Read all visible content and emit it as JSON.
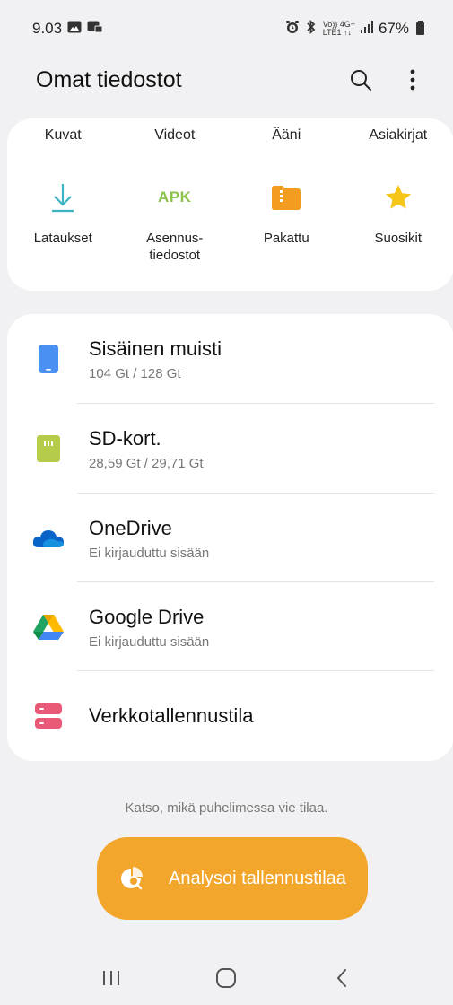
{
  "status": {
    "time": "9.03",
    "network_top": "Vo)) 4G+",
    "network_bottom": "LTE1 ↑↓",
    "battery": "67%"
  },
  "header": {
    "title": "Omat tiedostot"
  },
  "categories": {
    "text_items": [
      {
        "label": "Kuvat"
      },
      {
        "label": "Videot"
      },
      {
        "label": "Ääni"
      },
      {
        "label": "Asiakirjat"
      }
    ],
    "icon_items": [
      {
        "label": "Lataukset",
        "icon": "download-icon",
        "color": "#3bb3c3"
      },
      {
        "label": "Asennus-\ntiedostot",
        "icon": "apk-icon",
        "icon_text": "APK",
        "color": "#8bc34a"
      },
      {
        "label": "Pakattu",
        "icon": "folder-zip-icon",
        "color": "#f29d1f"
      },
      {
        "label": "Suosikit",
        "icon": "star-icon",
        "color": "#f5c518"
      }
    ]
  },
  "storage": {
    "items": [
      {
        "title": "Sisäinen muisti",
        "subtitle": "104 Gt / 128 Gt",
        "icon": "phone-icon",
        "color": "#4a8ff2"
      },
      {
        "title": "SD-kort.",
        "subtitle": "28,59 Gt / 29,71 Gt",
        "icon": "sd-card-icon",
        "color": "#b5cc4a"
      },
      {
        "title": "OneDrive",
        "subtitle": "Ei kirjauduttu sisään",
        "icon": "onedrive-icon",
        "color": "#0a64c8"
      },
      {
        "title": "Google Drive",
        "subtitle": "Ei kirjauduttu sisään",
        "icon": "google-drive-icon",
        "color": "#1fa463"
      },
      {
        "title": "Verkkotallennustila",
        "subtitle": "",
        "icon": "network-storage-icon",
        "color": "#e85a78"
      }
    ]
  },
  "analyze": {
    "hint": "Katso, mikä puhelimessa vie tilaa.",
    "button_label": "Analysoi tallennustilaa",
    "color": "#f2a62c"
  }
}
